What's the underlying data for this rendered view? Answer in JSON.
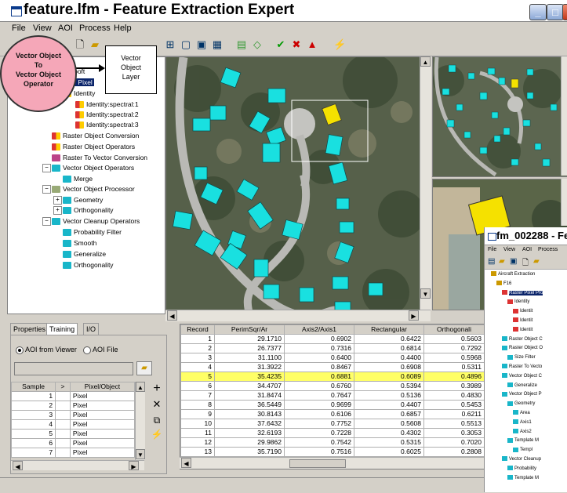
{
  "window": {
    "title": "feature.lfm - Feature Extraction Expert"
  },
  "menu": [
    "File",
    "View",
    "AOI",
    "Process",
    "Help"
  ],
  "callouts": {
    "operator_circle": [
      "Vector Object",
      "To",
      "Vector Object",
      "Operator"
    ],
    "vector_layer_box": [
      "Vector",
      "Object",
      "Layer"
    ]
  },
  "tree": {
    "items": [
      {
        "label": "ntial Rooft",
        "level": 0
      },
      {
        "label": "Raster Pixel",
        "level": 0,
        "selected": true
      },
      {
        "label": "Identity",
        "level": 1
      },
      {
        "label": "Identity:spectral:1",
        "level": 2
      },
      {
        "label": "Identity:spectral:2",
        "level": 2
      },
      {
        "label": "Identity:spectral:3",
        "level": 2
      },
      {
        "label": "Raster Object Conversion",
        "level": 0
      },
      {
        "label": "Raster Object Operators",
        "level": 0
      },
      {
        "label": "Raster To Vector Conversion",
        "level": 0
      },
      {
        "label": "Vector Object Operators",
        "level": 0
      },
      {
        "label": "Merge",
        "level": 1
      },
      {
        "label": "Vector Object Processor",
        "level": 0
      },
      {
        "label": "Geometry",
        "level": 1
      },
      {
        "label": "Orthogonality",
        "level": 1
      },
      {
        "label": "Vector Cleanup Operators",
        "level": 0
      },
      {
        "label": "Probability Filter",
        "level": 1
      },
      {
        "label": "Smooth",
        "level": 1
      },
      {
        "label": "Generalize",
        "level": 1
      },
      {
        "label": "Orthogonality",
        "level": 1
      }
    ]
  },
  "tabs": {
    "properties": "Properties",
    "training": "Training",
    "io": "I/O"
  },
  "aoi": {
    "from_viewer": "AOI from Viewer",
    "file": "AOI File"
  },
  "samples": {
    "headers": [
      "Sample",
      ">",
      "Pixel/Object"
    ],
    "rows": [
      {
        "n": "1",
        "v": "Pixel"
      },
      {
        "n": "2",
        "v": "Pixel"
      },
      {
        "n": "3",
        "v": "Pixel"
      },
      {
        "n": "4",
        "v": "Pixel"
      },
      {
        "n": "5",
        "v": "Pixel"
      },
      {
        "n": "6",
        "v": "Pixel"
      },
      {
        "n": "7",
        "v": "Pixel"
      }
    ]
  },
  "records": {
    "headers": [
      "Record",
      "PerimSqr/Ar",
      "Axis2/Axis1",
      "Rectangular",
      "Orthogonali"
    ],
    "highlight_index": 4,
    "rows": [
      [
        "1",
        "29.1710",
        "0.6902",
        "0.6422",
        "0.5603"
      ],
      [
        "2",
        "26.7377",
        "0.7316",
        "0.6814",
        "0.7292"
      ],
      [
        "3",
        "31.1100",
        "0.6400",
        "0.4400",
        "0.5968"
      ],
      [
        "4",
        "31.3922",
        "0.8467",
        "0.6908",
        "0.5311"
      ],
      [
        "5",
        "35.4235",
        "0.6881",
        "0.6089",
        "0.4896"
      ],
      [
        "6",
        "34.4707",
        "0.6760",
        "0.5394",
        "0.3989"
      ],
      [
        "7",
        "31.8474",
        "0.7647",
        "0.5136",
        "0.4830"
      ],
      [
        "8",
        "36.5449",
        "0.9699",
        "0.4407",
        "0.5453"
      ],
      [
        "9",
        "30.8143",
        "0.6106",
        "0.6857",
        "0.6211"
      ],
      [
        "10",
        "37.6432",
        "0.7752",
        "0.5608",
        "0.5513"
      ],
      [
        "11",
        "32.6193",
        "0.7228",
        "0.4302",
        "0.3053"
      ],
      [
        "12",
        "29.9862",
        "0.7542",
        "0.5315",
        "0.7020"
      ],
      [
        "13",
        "35.7190",
        "0.7516",
        "0.6025",
        "0.2808"
      ]
    ]
  },
  "second_window": {
    "title": "fm_002288 - Fe",
    "menu": [
      "File",
      "View",
      "AOI",
      "Process"
    ],
    "tree": [
      "Aircraft Extraction",
      "F16",
      "Raster Pixel Pro",
      "Identity",
      "Identit",
      "Identit",
      "Identit",
      "Raster Object C",
      "Raster Object O",
      "Size Filter",
      "Raster To Vecto",
      "Vector Object C",
      "Generalize",
      "Vector Object P",
      "Geometry",
      "Area",
      "Axis1",
      "Axis2",
      "Template M",
      "Templ",
      "Vector Cleanup",
      "Probability",
      "Template M"
    ]
  },
  "colors": {
    "roof": "#19e0e0",
    "selected_roof": "#f5e100",
    "highlight_row": "#ffff66",
    "callout": "#f5a7b8"
  }
}
